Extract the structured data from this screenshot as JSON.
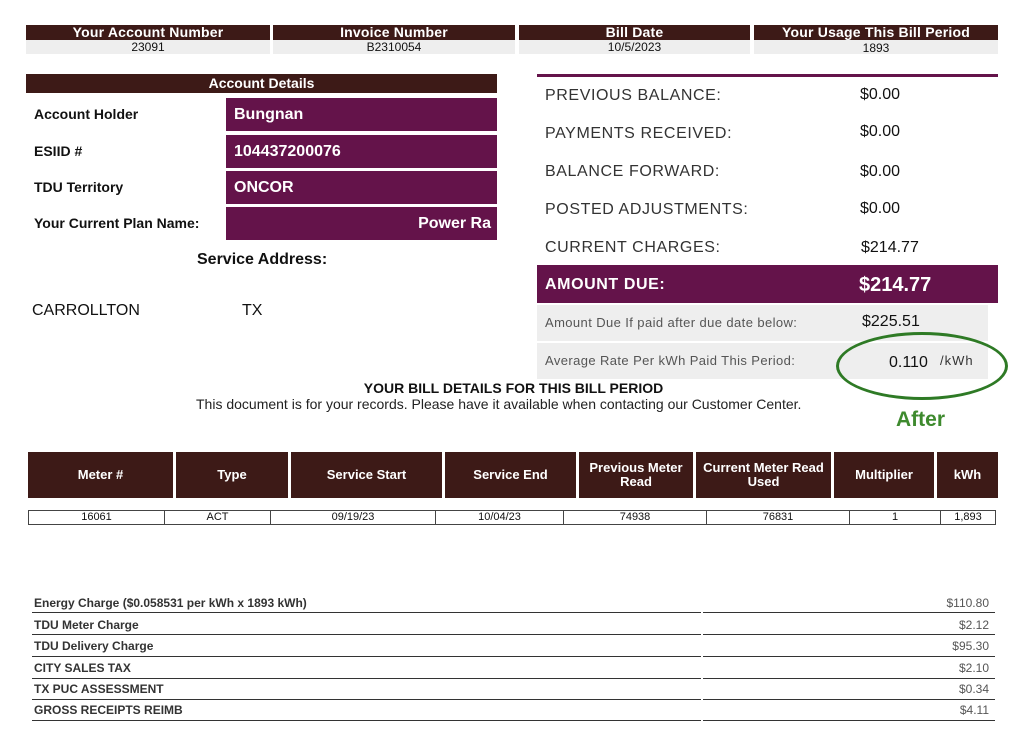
{
  "header": [
    {
      "label": "Your Account Number",
      "value": "23091"
    },
    {
      "label": "Invoice Number",
      "value": "B2310054"
    },
    {
      "label": "Bill Date",
      "value": "10/5/2023"
    },
    {
      "label": "Your Usage This Bill Period",
      "value": "1893"
    }
  ],
  "account": {
    "title": "Account Details",
    "holder_label": "Account Holder",
    "holder_value": "Bungnan",
    "esiid_label": "ESIID #",
    "esiid_value": "104437200076",
    "tdu_label": "TDU Territory",
    "tdu_value": "ONCOR",
    "plan_label": "Your Current Plan Name:",
    "plan_value": "Power Ra",
    "service_address_label": "Service Address:",
    "city": "CARROLLTON",
    "state": "TX"
  },
  "summary": {
    "previous_balance_label": "PREVIOUS BALANCE:",
    "previous_balance_value": "$0.00",
    "payments_received_label": "PAYMENTS RECEIVED:",
    "payments_received_value": "$0.00",
    "balance_forward_label": "BALANCE FORWARD:",
    "balance_forward_value": "$0.00",
    "posted_adjustments_label": "POSTED ADJUSTMENTS:",
    "posted_adjustments_value": "$0.00",
    "current_charges_label": "CURRENT CHARGES:",
    "current_charges_value": "$214.77",
    "amount_due_label": "AMOUNT DUE:",
    "amount_due_value": "$214.77",
    "late_label": "Amount Due If paid after due date below:",
    "late_value": "$225.51",
    "avg_rate_label": "Average Rate Per kWh Paid This Period:",
    "avg_rate_value": "0.110",
    "avg_rate_unit": "/kWh",
    "annotation": "After"
  },
  "bill_details": {
    "title": "YOUR BILL DETAILS FOR THIS BILL PERIOD",
    "subtitle": "This document is for your records. Please have it available when contacting our Customer Center."
  },
  "meter_table": {
    "headers": [
      "Meter #",
      "Type",
      "Service Start",
      "Service End",
      "Previous Meter Read",
      "Current Meter Read Used",
      "Multiplier",
      "kWh"
    ],
    "row": [
      "16061",
      "ACT",
      "09/19/23",
      "10/04/23",
      "74938",
      "76831",
      "1",
      "1,893"
    ]
  },
  "charges": [
    {
      "label": "Energy Charge ($0.058531 per kWh x 1893 kWh)",
      "amount": "$110.80"
    },
    {
      "label": "TDU Meter Charge",
      "amount": "$2.12"
    },
    {
      "label": "TDU Delivery Charge",
      "amount": "$95.30"
    },
    {
      "label": "CITY SALES TAX",
      "amount": "$2.10"
    },
    {
      "label": "TX PUC ASSESSMENT",
      "amount": "$0.34"
    },
    {
      "label": "GROSS RECEIPTS REIMB",
      "amount": "$4.11"
    }
  ],
  "colors": {
    "header_brown": "#3d1a17",
    "accent_plum": "#64134a",
    "annotation_green": "#2e7a25"
  }
}
